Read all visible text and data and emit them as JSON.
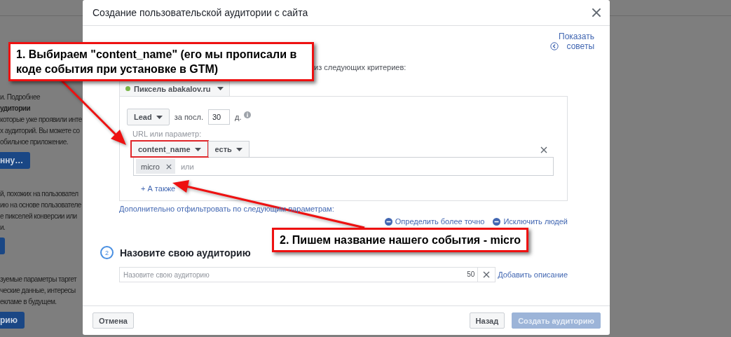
{
  "background_page": {
    "items": [
      {
        "kind": "text",
        "text": "и. Подробнее"
      },
      {
        "kind": "heading",
        "text": "удитории"
      },
      {
        "kind": "text",
        "text": "которые уже проявили инте"
      },
      {
        "kind": "text",
        "text": "х аудиторий. Вы можете со"
      },
      {
        "kind": "text",
        "text": "обильное приложение."
      },
      {
        "kind": "button",
        "text": "нну…"
      },
      {
        "kind": "gap"
      },
      {
        "kind": "text",
        "text": "й, похожих на пользовател"
      },
      {
        "kind": "text",
        "text": "ию на основе пользователе"
      },
      {
        "kind": "text",
        "text": "е пикселей конверсии или"
      },
      {
        "kind": "text",
        "text": "и."
      },
      {
        "kind": "button"
      },
      {
        "kind": "gap"
      },
      {
        "kind": "text",
        "text": "зуемые параметры таргет"
      },
      {
        "kind": "text",
        "text": "ческие данные, интересы"
      },
      {
        "kind": "text",
        "text": "екламе в будущем."
      },
      {
        "kind": "button",
        "text": "рию"
      }
    ]
  },
  "dialog": {
    "title": "Создание пользовательской аудитории с сайта",
    "tips_link": [
      "Показать",
      "советы"
    ],
    "criteria_text": "из следующих критериев:",
    "pixel": {
      "label": "Пиксель abakalov.ru",
      "color": "#7ab648"
    },
    "rule": {
      "event": "Lead",
      "period_label": "за посл.",
      "days": "30",
      "days_unit": "д.",
      "param_label": "URL или параметр:",
      "param": {
        "label": "content_name",
        "highlighted": true
      },
      "operator": "есть",
      "tags": [
        {
          "label": "micro"
        }
      ],
      "tag_placeholder": "или",
      "add_link": "+ А также"
    },
    "filter_link": "Дополнительно отфильтровать по следующим параметрам:",
    "actions": [
      "Определить более точно",
      "Исключить людей"
    ],
    "step2": {
      "number": "2",
      "title": "Назовите свою аудиторию",
      "placeholder": "Назовите свою аудиторию",
      "counter": "50",
      "description_link": "Добавить описание"
    },
    "footer_left": [
      {
        "label": "Отмена",
        "kind": "secondary",
        "disabled": false
      }
    ],
    "footer_right": [
      {
        "label": "Назад",
        "kind": "secondary",
        "disabled": false
      },
      {
        "label": "Создать аудиторию",
        "kind": "primary",
        "disabled": true
      }
    ]
  },
  "annotations": [
    {
      "text": "1. Выбираем \"content_name\" (его мы прописали в коде события при установке в GTM)"
    },
    {
      "text": "2. Пишем название нашего события - micro"
    }
  ]
}
